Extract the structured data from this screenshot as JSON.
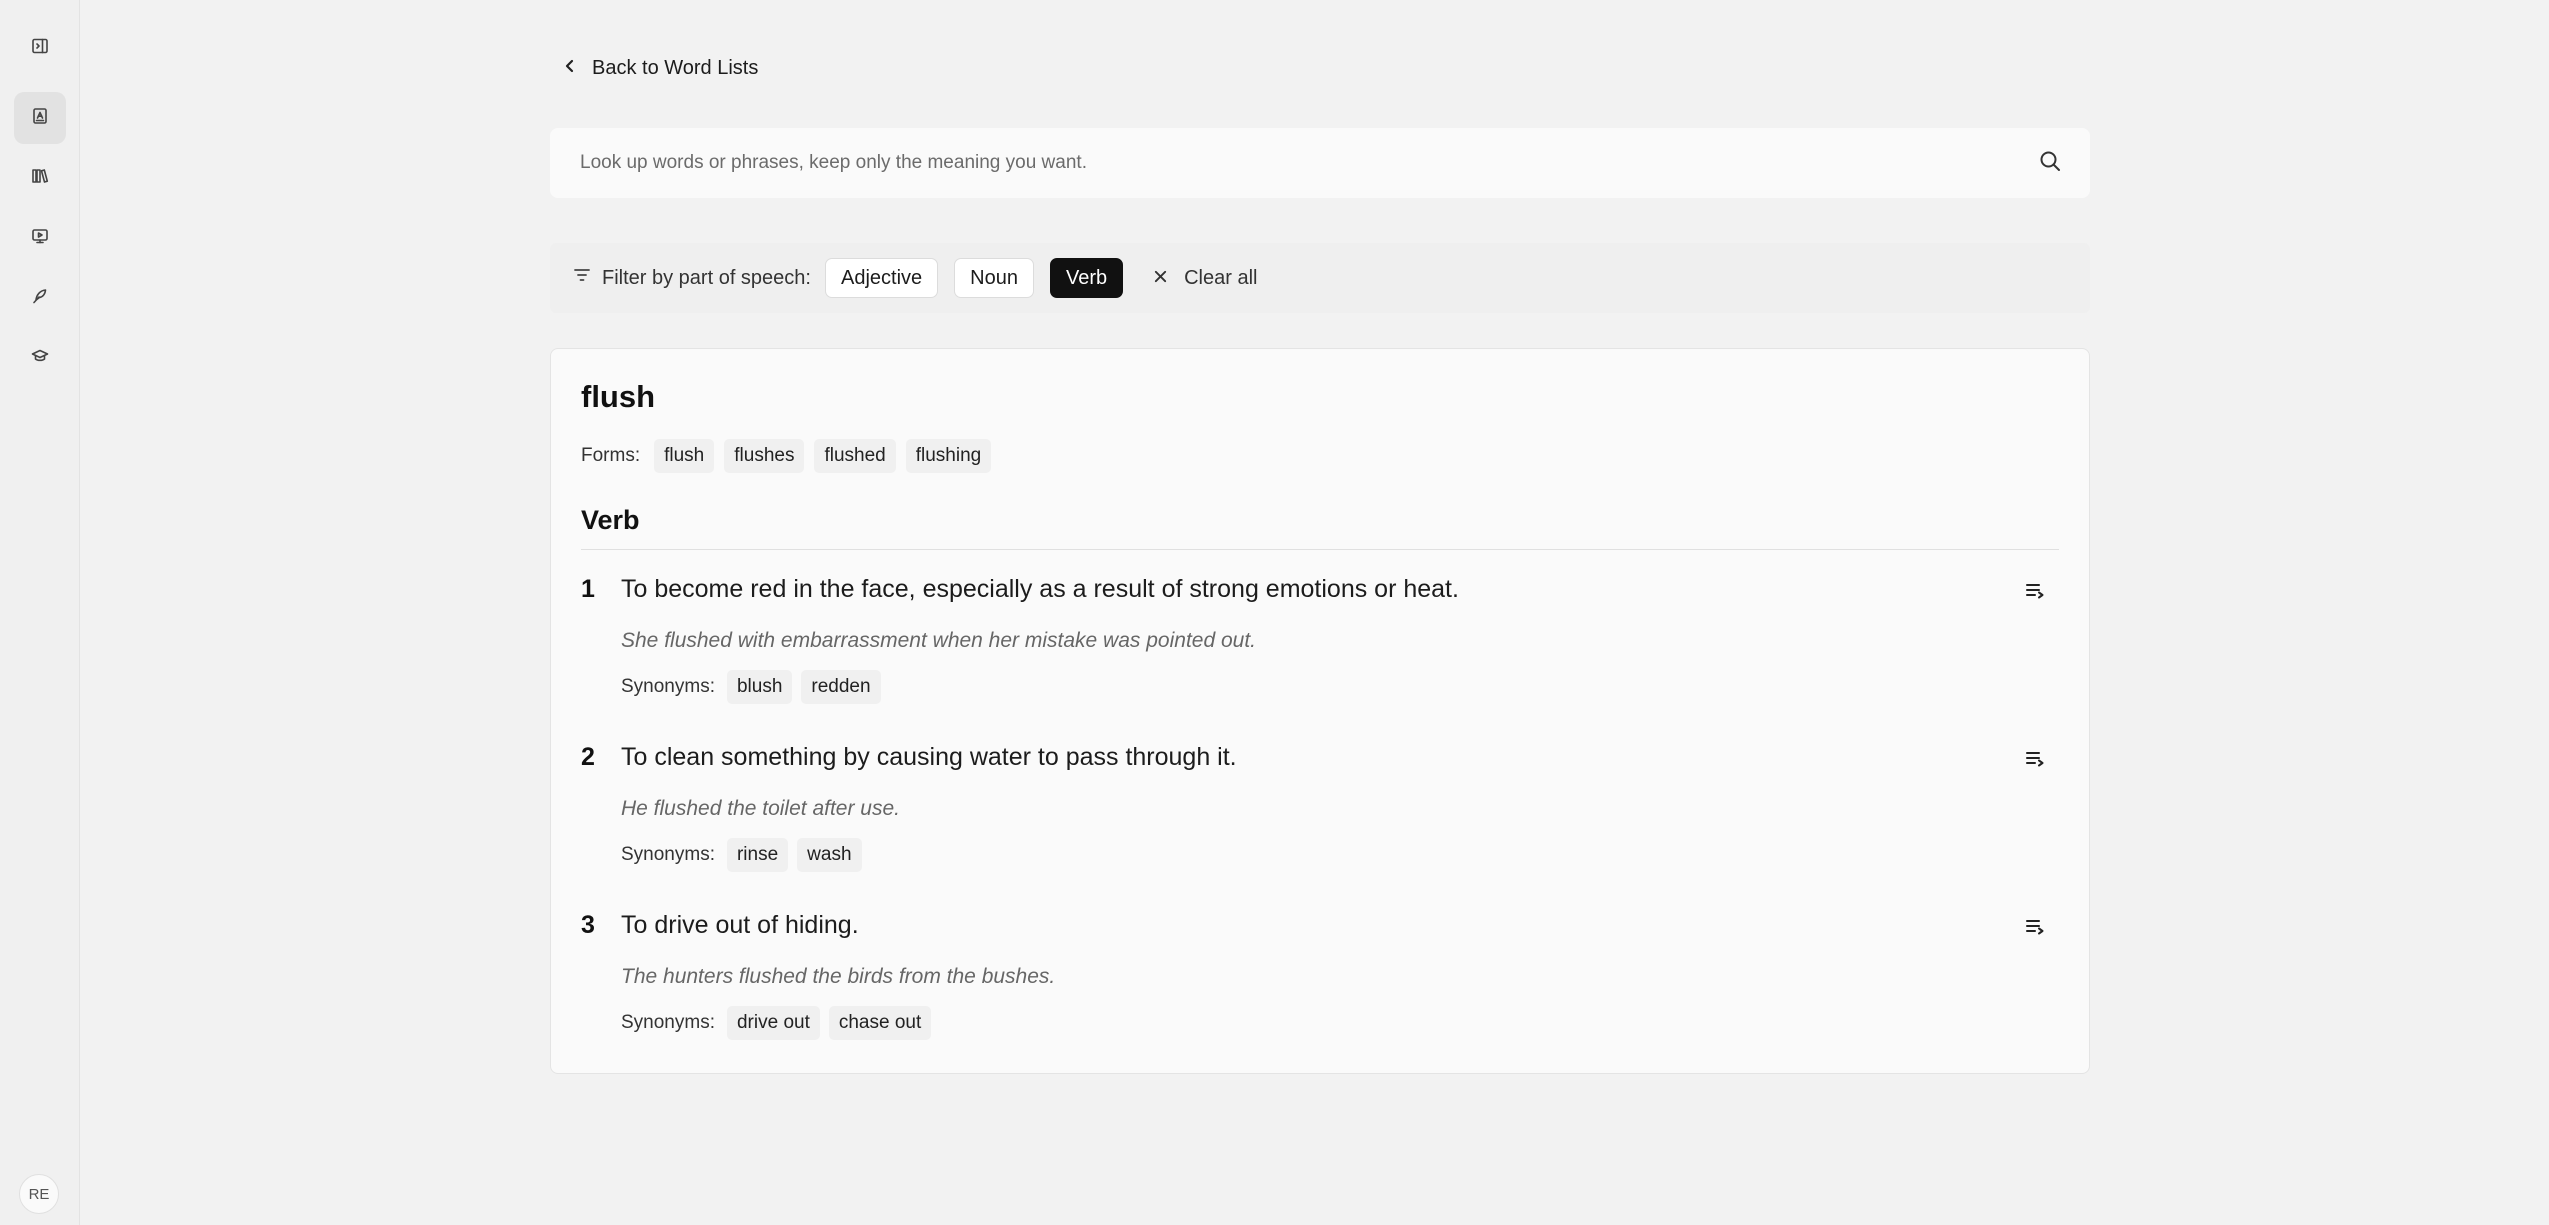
{
  "sidebar": {
    "items": [
      {
        "icon": "sidebar-toggle-icon"
      },
      {
        "icon": "word-book-icon",
        "active": true
      },
      {
        "icon": "library-icon"
      },
      {
        "icon": "video-presentation-icon"
      },
      {
        "icon": "quill-icon"
      },
      {
        "icon": "graduation-cap-icon"
      }
    ],
    "avatar": "RE"
  },
  "back": {
    "label": "Back to Word Lists"
  },
  "search": {
    "placeholder": "Look up words or phrases, keep only the meaning you want.",
    "value": ""
  },
  "filter": {
    "label": "Filter by part of speech:",
    "chips": [
      {
        "label": "Adjective",
        "active": false
      },
      {
        "label": "Noun",
        "active": false
      },
      {
        "label": "Verb",
        "active": true
      }
    ],
    "clear_label": "Clear all"
  },
  "entry": {
    "word": "flush",
    "forms_label": "Forms:",
    "forms": [
      "flush",
      "flushes",
      "flushed",
      "flushing"
    ],
    "part_of_speech": "Verb",
    "senses": [
      {
        "number": "1",
        "definition": "To become red in the face, especially as a result of strong emotions or heat.",
        "example": "She flushed with embarrassment when her mistake was pointed out.",
        "synonyms_label": "Synonyms:",
        "synonyms": [
          "blush",
          "redden"
        ]
      },
      {
        "number": "2",
        "definition": "To clean something by causing water to pass through it.",
        "example": "He flushed the toilet after use.",
        "synonyms_label": "Synonyms:",
        "synonyms": [
          "rinse",
          "wash"
        ]
      },
      {
        "number": "3",
        "definition": "To drive out of hiding.",
        "example": "The hunters flushed the birds from the bushes.",
        "synonyms_label": "Synonyms:",
        "synonyms": [
          "drive out",
          "chase out"
        ]
      }
    ]
  },
  "colors": {
    "background": "#f2f2f2",
    "card": "#fafafa",
    "active_chip": "#111111",
    "text": "#1c1c1c",
    "muted": "#666666"
  }
}
